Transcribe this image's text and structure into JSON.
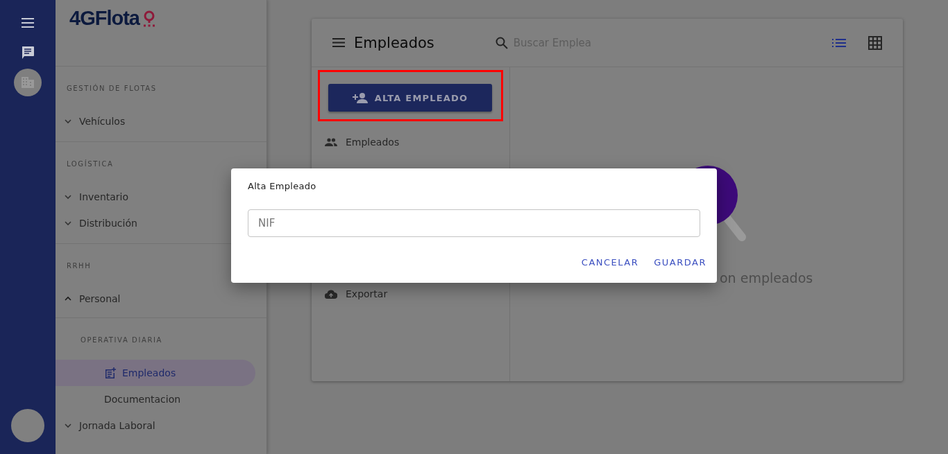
{
  "logo": "4GFlota",
  "sidebar": {
    "sections": [
      {
        "title": "GESTIÓN DE FLOTAS",
        "items": [
          {
            "label": "Vehículos",
            "expanded": false
          }
        ]
      },
      {
        "title": "LOGÍSTICA",
        "items": [
          {
            "label": "Inventario",
            "expanded": false
          },
          {
            "label": "Distribución",
            "expanded": false
          }
        ]
      },
      {
        "title": "RRHH",
        "items": [
          {
            "label": "Personal",
            "expanded": true,
            "children": {
              "title": "OPERATIVA DIARIA",
              "items": [
                {
                  "label": "Empleados",
                  "selected": true,
                  "kind": "icon"
                },
                {
                  "label": "Documentacion",
                  "selected": false,
                  "kind": "text"
                }
              ]
            }
          },
          {
            "label": "Jornada Laboral",
            "expanded": false
          }
        ]
      }
    ]
  },
  "card": {
    "title": "Empleados",
    "search": {
      "placeholder": "Buscar Emplea"
    },
    "views": [
      {
        "kind": "list",
        "selected": true
      },
      {
        "kind": "grid",
        "selected": false
      }
    ],
    "add_button": "ALTA EMPLEADO",
    "menu": [
      {
        "label": "Empleados",
        "kind": "people"
      },
      {
        "label": "Exportar",
        "kind": "upload"
      }
    ],
    "empty_text": "on empleados"
  },
  "dialog": {
    "title": "Alta Empleado",
    "field": {
      "placeholder": "NIF"
    },
    "buttons": [
      "CANCELAR",
      "GUARDAR"
    ]
  }
}
